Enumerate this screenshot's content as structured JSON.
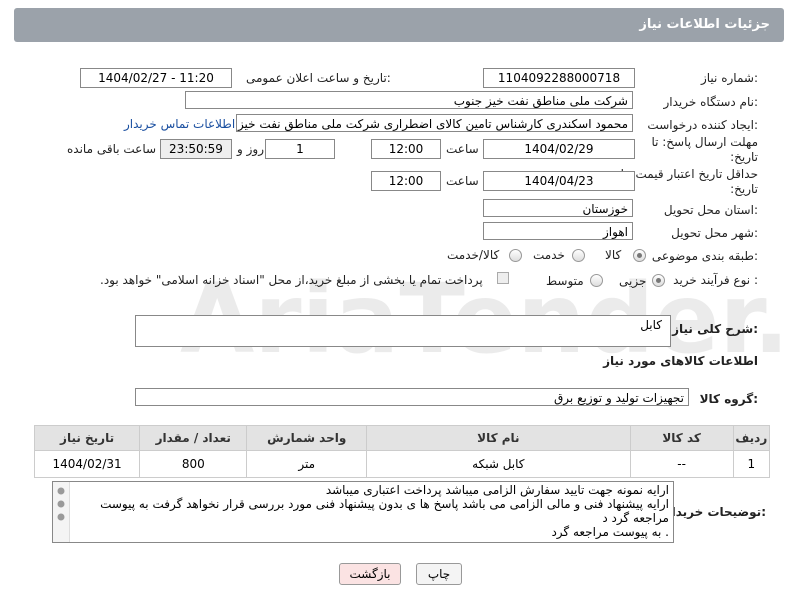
{
  "header": {
    "title": "جزئیات اطلاعات نیاز"
  },
  "form": {
    "need_number_label": "شماره نیاز:",
    "need_number": "1104092288000718",
    "announce_label": "تاریخ و ساعت اعلان عمومی:",
    "announce_value": "1404/02/27 - 11:20",
    "buyer_org_label": "نام دستگاه خریدار:",
    "buyer_org": "شرکت ملی مناطق نفت خیز جنوب",
    "creator_label": "ایجاد کننده درخواست:",
    "creator": "محمود  اسکندری کارشناس تامین کالای اضطراری شرکت ملی مناطق نفت خیز",
    "contact_link": "اطلاعات تماس خریدار",
    "deadline_label": "مهلت ارسال پاسخ: تا تاریخ:",
    "deadline_date": "1404/02/29",
    "time_label": "ساعت",
    "deadline_time": "12:00",
    "days_value": "1",
    "days_label": "روز و",
    "remaining_time": "23:50:59",
    "remaining_label": "ساعت باقی مانده",
    "price_valid_label": "حداقل تاریخ اعتبار قیمت: تا تاریخ:",
    "price_valid_date": "1404/04/23",
    "price_valid_time": "12:00",
    "province_label": "استان محل تحویل:",
    "province": "خوزستان",
    "city_label": "شهر محل تحویل:",
    "city": "اهواز",
    "category_label": "طبقه بندی موضوعی:",
    "category_options": [
      "کالا",
      "خدمت",
      "کالا/خدمت"
    ],
    "category_selected": "کالا",
    "process_label": "نوع فرآیند خرید :",
    "process_options": [
      "جزیی",
      "متوسط"
    ],
    "process_selected": "جزیی",
    "payment_note": "پرداخت تمام یا بخشی از مبلغ خرید،از محل \"اسناد خزانه اسلامی\" خواهد بود."
  },
  "summary": {
    "label": "شرح کلی نیاز:",
    "value": "کابل"
  },
  "goods_section": {
    "title": "اطلاعات کالاهای مورد نیاز",
    "group_label": "گروه کالا:",
    "group_value": "تجهیزات تولید و توزیع برق"
  },
  "items_table": {
    "headers": [
      "ردیف",
      "کد کالا",
      "نام کالا",
      "واحد شمارش",
      "تعداد / مقدار",
      "تاریخ نیاز"
    ],
    "rows": [
      [
        "1",
        "--",
        "کابل شبکه",
        "متر",
        "800",
        "1404/02/31"
      ]
    ]
  },
  "buyer_notes": {
    "label": "توضیحات خریدار:",
    "lines": [
      "ارایه نمونه جهت تایید سفارش الزامی میباشد پرداخت اعتباری میباشد",
      "ارایه پیشنهاد فنی و مالی الزامی می باشد پاسخ ها ی بدون پیشنهاد فنی مورد بررسی قرار نخواهد گرفت به پیوست مراجعه گرد د",
      ". به پیوست مراجعه گرد"
    ]
  },
  "buttons": {
    "print": "چاپ",
    "back": "بازگشت"
  },
  "watermark": "AriaTender.net",
  "colors": {
    "titlebar": "#9ba2aa",
    "link": "#1a4fa0",
    "back_button_bg": "#fbe3e3"
  }
}
